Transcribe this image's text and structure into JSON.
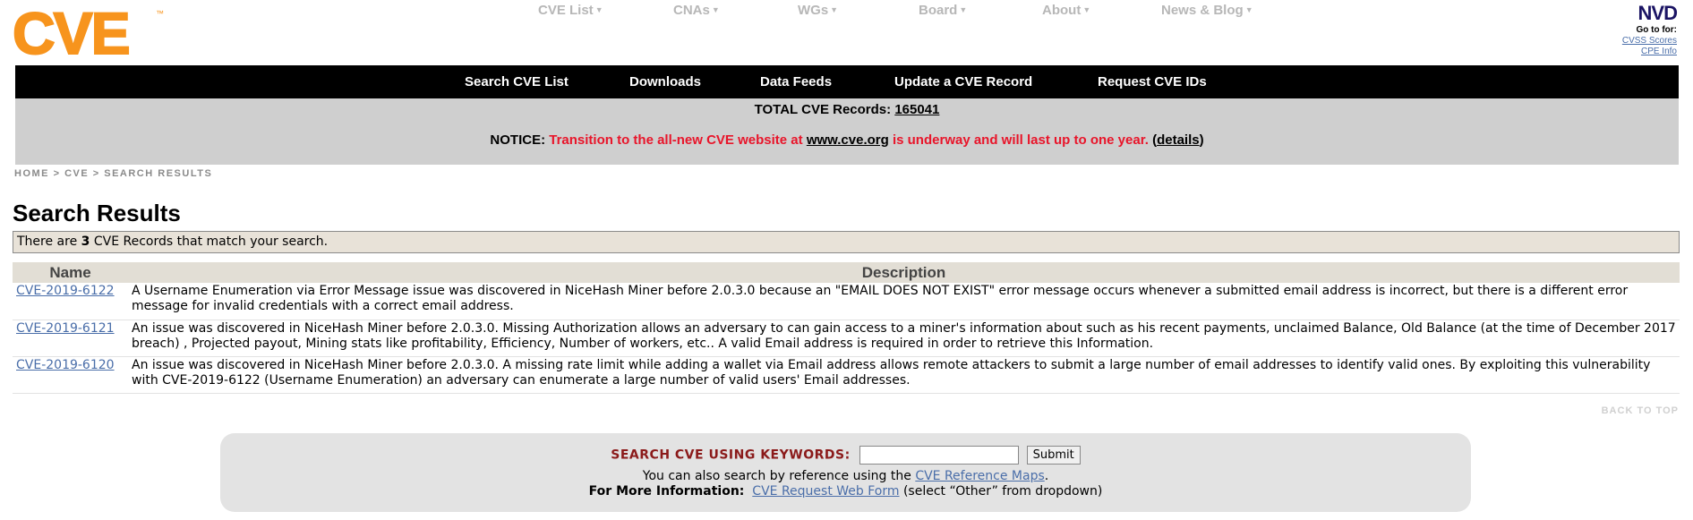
{
  "brand": {
    "logo_text": "CVE",
    "trademark": "™"
  },
  "topnav": [
    {
      "label": "CVE List"
    },
    {
      "label": "CNAs"
    },
    {
      "label": "WGs"
    },
    {
      "label": "Board"
    },
    {
      "label": "About"
    },
    {
      "label": "News & Blog"
    }
  ],
  "nvd": {
    "logo": "NVD",
    "goto": "Go to for:",
    "cvss": "CVSS Scores",
    "cpe": "CPE Info"
  },
  "navbar": [
    "Search CVE List",
    "Downloads",
    "Data Feeds",
    "Update a CVE Record",
    "Request CVE IDs"
  ],
  "total": {
    "label": "TOTAL CVE Records:",
    "count": "165041"
  },
  "notice": {
    "label": "NOTICE:",
    "text1": "Transition to the all-new CVE website at",
    "link": "www.cve.org",
    "text2": "is underway and will last up to one year.",
    "details_open": "(",
    "details_link": "details",
    "details_close": ")"
  },
  "breadcrumb": {
    "home": "HOME",
    "sep": ">",
    "cve": "CVE",
    "current": "SEARCH RESULTS"
  },
  "page_title": "Search Results",
  "match": {
    "prefix": "There are",
    "count": "3",
    "suffix": "CVE Records that match your search."
  },
  "table": {
    "headers": {
      "name": "Name",
      "description": "Description"
    },
    "rows": [
      {
        "id": "CVE-2019-6122",
        "description": "A Username Enumeration via Error Message issue was discovered in NiceHash Miner before 2.0.3.0 because an \"EMAIL DOES NOT EXIST\" error message occurs whenever a submitted email address is incorrect, but there is a different error message for invalid credentials with a correct email address."
      },
      {
        "id": "CVE-2019-6121",
        "description": "An issue was discovered in NiceHash Miner before 2.0.3.0. Missing Authorization allows an adversary to can gain access to a miner's information about such as his recent payments, unclaimed Balance, Old Balance (at the time of December 2017 breach) , Projected payout, Mining stats like profitability, Efficiency, Number of workers, etc.. A valid Email address is required in order to retrieve this Information."
      },
      {
        "id": "CVE-2019-6120",
        "description": "An issue was discovered in NiceHash Miner before 2.0.3.0. A missing rate limit while adding a wallet via Email address allows remote attackers to submit a large number of email addresses to identify valid ones. By exploiting this vulnerability with CVE-2019-6122 (Username Enumeration) an adversary can enumerate a large number of valid users' Email addresses."
      }
    ]
  },
  "back_to_top": "BACK TO TOP",
  "search": {
    "label": "SEARCH CVE USING KEYWORDS:",
    "input_value": "",
    "submit": "Submit",
    "ref_prefix": "You can also search by reference using the",
    "ref_link": "CVE Reference Maps",
    "ref_suffix": ".",
    "info_label": "For More Information:",
    "info_link": "CVE Request Web Form",
    "info_suffix": "(select “Other” from dropdown)"
  },
  "colors": {
    "logo_orange": "#f7941d",
    "notice_red": "#e8152a",
    "link_blue": "#4a6ea9",
    "nvd_navy": "#1b1464"
  }
}
